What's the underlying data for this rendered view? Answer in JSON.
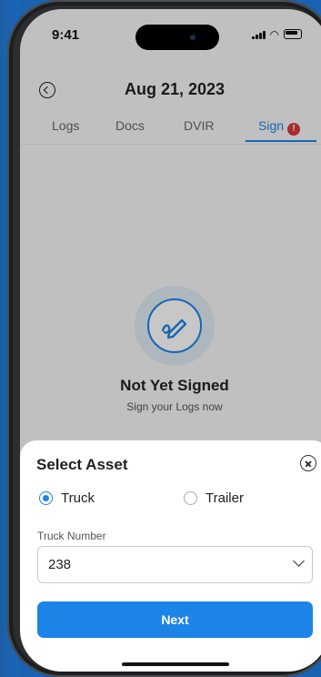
{
  "status_bar": {
    "time": "9:41"
  },
  "header": {
    "title": "Aug 21, 2023"
  },
  "tabs": [
    {
      "label": "Logs"
    },
    {
      "label": "Docs"
    },
    {
      "label": "DVIR"
    },
    {
      "label": "Sign",
      "badge": "!"
    }
  ],
  "empty_state": {
    "title": "Not Yet Signed",
    "subtitle": "Sign your Logs now"
  },
  "sheet": {
    "title": "Select Asset",
    "options": [
      {
        "label": "Truck",
        "selected": true
      },
      {
        "label": "Trailer",
        "selected": false
      }
    ],
    "field_label": "Truck Number",
    "field_value": "238",
    "button_label": "Next"
  },
  "colors": {
    "accent": "#1b84e6",
    "alert": "#d93a3a",
    "backdrop": "#1a63b0"
  }
}
